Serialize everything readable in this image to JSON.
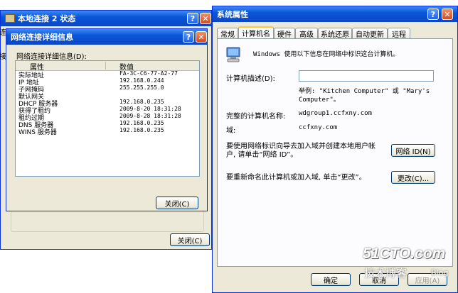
{
  "local_conn": {
    "title": "本地连接 2 状态",
    "close_label": "关闭(C)",
    "left_fragments": [
      "连",
      "接"
    ]
  },
  "net_details": {
    "title": "网络连接详细信息",
    "list_label": "网络连接详细信息(D):",
    "col_property": "属性",
    "col_value": "数值",
    "rows": [
      {
        "prop": "实际地址",
        "value": "FA-3C-C6-77-A2-77"
      },
      {
        "prop": "IP 地址",
        "value": "192.168.0.244"
      },
      {
        "prop": "子网掩码",
        "value": "255.255.255.0"
      },
      {
        "prop": "默认网关",
        "value": ""
      },
      {
        "prop": "DHCP 服务器",
        "value": "192.168.0.235"
      },
      {
        "prop": "获得了租约",
        "value": "2009-8-20 18:31:28"
      },
      {
        "prop": "租约过期",
        "value": "2009-8-28 18:31:28"
      },
      {
        "prop": "DNS 服务器",
        "value": "192.168.0.235"
      },
      {
        "prop": "WINS 服务器",
        "value": "192.168.0.235"
      }
    ],
    "close_label": "关闭(C)"
  },
  "sysprops": {
    "title": "系统属性",
    "tabs": [
      "常规",
      "计算机名",
      "硬件",
      "高级",
      "系统还原",
      "自动更新",
      "远程"
    ],
    "active_tab": 1,
    "intro": "Windows 使用以下信息在网络中标识这台计算机。",
    "desc_label": "计算机描述(D):",
    "desc_value": "",
    "example": "举例: \"Kitchen Computer\" 或 \"Mary's Computer\"。",
    "fullname_label": "完整的计算机名称:",
    "fullname_value": "wdgroup1.ccfxny.com",
    "domain_label": "域:",
    "domain_value": "ccfxny.com",
    "netid_text": "要使用网络标识向导去加入域并创建本地用户帐户, 请单击“网络 ID”。",
    "netid_button": "网络 ID(N)",
    "rename_text": "要重新命名此计算机或加入域, 单击“更改”。",
    "change_button": "更改(C)...",
    "ok_button": "确定",
    "cancel_button": "取消",
    "apply_button": "应用(A)"
  },
  "watermark": {
    "logo": "51CTO.com",
    "sub": "技术博客",
    "blog": "Blog"
  },
  "colors": {
    "xp_face": "#ece9d8",
    "xp_blue": "#0a56d8",
    "close_red": "#d64b1c"
  }
}
